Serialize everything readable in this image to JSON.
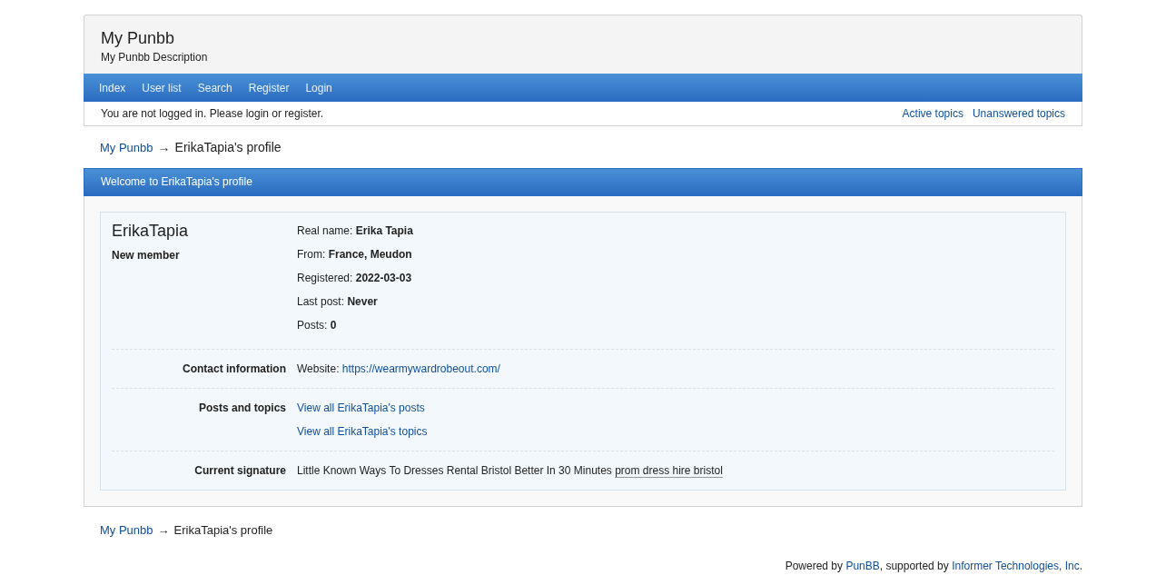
{
  "board": {
    "title": "My Punbb",
    "description": "My Punbb Description"
  },
  "nav": [
    {
      "label": "Index"
    },
    {
      "label": "User list"
    },
    {
      "label": "Search"
    },
    {
      "label": "Register"
    },
    {
      "label": "Login"
    }
  ],
  "status": {
    "message": "You are not logged in. Please login or register.",
    "links": [
      "Active topics",
      "Unanswered topics"
    ]
  },
  "crumbs_top": {
    "link": "My Punbb",
    "arrow": "→",
    "current": "ErikaTapia's profile"
  },
  "panel": {
    "heading": "Welcome to ErikaTapia's profile",
    "username": "ErikaTapia",
    "user_title": "New member",
    "info": [
      {
        "label": "Real name:",
        "value": "Erika Tapia"
      },
      {
        "label": "From:",
        "value": "France, Meudon"
      },
      {
        "label": "Registered:",
        "value": "2022-03-03"
      },
      {
        "label": "Last post:",
        "value": "Never"
      },
      {
        "label": "Posts:",
        "value": "0"
      }
    ],
    "sections": [
      {
        "heading": "Contact information",
        "rows": [
          {
            "kind": "field",
            "label": "Website:",
            "link": "https://wearmywardrobeout.com/"
          }
        ]
      },
      {
        "heading": "Posts and topics",
        "rows": [
          {
            "kind": "link",
            "link": "View all ErikaTapia's posts"
          },
          {
            "kind": "link",
            "link": "View all ErikaTapia's topics"
          }
        ]
      },
      {
        "heading": "Current signature",
        "rows": [
          {
            "kind": "signature",
            "text": "Little Known Ways To Dresses Rental Bristol Better In 30 Minutes",
            "link": "prom dress hire bristol"
          }
        ]
      }
    ]
  },
  "crumbs_bottom": {
    "link": "My Punbb",
    "arrow": "→",
    "current": "ErikaTapia's profile"
  },
  "footer": {
    "prefix": "Powered by ",
    "link1": "PunBB",
    "middle": ", supported by ",
    "link2": "Informer Technologies, Inc",
    "suffix": "."
  }
}
